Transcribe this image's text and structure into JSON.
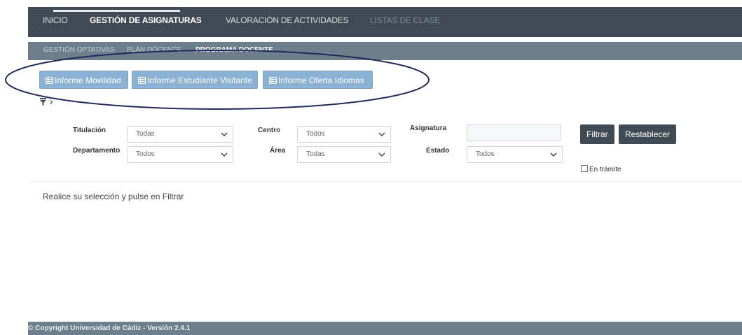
{
  "top_nav": {
    "items": [
      {
        "label": "INICIO"
      },
      {
        "label": "GESTIÓN DE ASIGNATURAS"
      },
      {
        "label": "VALORACIÓN DE ACTIVIDADES"
      },
      {
        "label": "LISTAS DE CLASE"
      }
    ],
    "active_index": 1
  },
  "sub_nav": {
    "items": [
      {
        "label": "GESTIÓN OPTATIVAS"
      },
      {
        "label": "PLAN DOCENTE"
      },
      {
        "label": "PROGRAMA DOCENTE"
      }
    ],
    "active_index": 2
  },
  "reports": {
    "buttons": [
      {
        "label": "Informe Movilidad"
      },
      {
        "label": "Informe Estudiante Visitante"
      },
      {
        "label": "Informe Oferta Idiomas"
      }
    ],
    "icon": "table-icon"
  },
  "filter_toggle": {
    "icon": "filter-icon",
    "chevron": "›"
  },
  "filters": {
    "titulacion": {
      "label": "Titulación",
      "value": "Todas"
    },
    "centro": {
      "label": "Centro",
      "value": "Todos"
    },
    "asignatura": {
      "label": "Asignatura",
      "value": ""
    },
    "departamento": {
      "label": "Departamento",
      "value": "Todos"
    },
    "area": {
      "label": "Área",
      "value": "Todas"
    },
    "estado": {
      "label": "Estado",
      "value": "Todos"
    },
    "en_tramite": {
      "label": "En trámite",
      "checked": false
    }
  },
  "actions": {
    "filter_label": "Filtrar",
    "reset_label": "Restablecer"
  },
  "message": "Realice su selección y pulse en Filtrar",
  "footer": {
    "copyright": "© Copyright Universidad de Cádiz - Versión 2.4.1"
  },
  "colors": {
    "topbar": "#3f4a54",
    "subbar": "#6e7f8c",
    "report_button": "#8bb2d2",
    "annotation_ellipse": "#1f2a5a"
  }
}
